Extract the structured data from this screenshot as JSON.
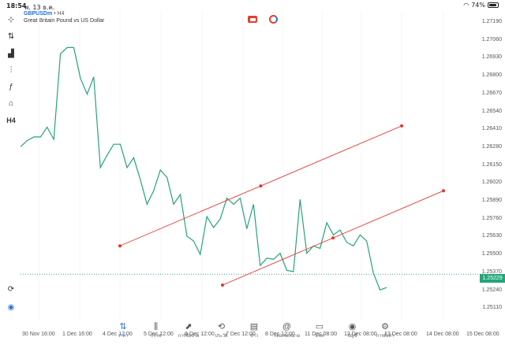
{
  "status_bar": {
    "time": "18:54",
    "date": "พ. 13 ธ.ค.",
    "battery": "74%",
    "battery_level": 0.74
  },
  "symbol": {
    "name": "GBPUSDm",
    "separator": "•",
    "timeframe": "H4",
    "description": "Great Britain Pound vs US Dollar"
  },
  "toolbar": {
    "items": [
      {
        "name": "crosshair-icon",
        "glyph": "⊹"
      },
      {
        "name": "chart-type-icon",
        "glyph": "⇅"
      },
      {
        "name": "indicators-icon",
        "glyph": "▟"
      },
      {
        "name": "settings-sliders-icon",
        "glyph": "⫶"
      },
      {
        "name": "function-icon",
        "glyph": "ƒ"
      },
      {
        "name": "shapes-icon",
        "glyph": "⌂"
      },
      {
        "name": "timeframe-label",
        "glyph": "H4"
      }
    ],
    "bottom_items": [
      {
        "name": "zoom-icon",
        "glyph": "⟳"
      },
      {
        "name": "broker-icon",
        "glyph": "◉"
      }
    ]
  },
  "price_axis": [
    "1.27190",
    "1.27060",
    "1.26930",
    "1.26800",
    "1.26670",
    "1.26540",
    "1.26410",
    "1.26280",
    "1.26150",
    "1.26020",
    "1.25890",
    "1.25760",
    "1.25630",
    "1.25500",
    "1.25370",
    "1.25240",
    "1.25110"
  ],
  "current_price": "1.25229",
  "time_axis": [
    "30 Nov 16:00",
    "1 Dec 16:00",
    "4 Dec 12:00",
    "5 Dec 12:00",
    "6 Dec 12:00",
    "7 Dec 12:00",
    "8 Dec 12:00",
    "11 Dec 08:00",
    "12 Dec 08:00",
    "13 Dec 08:00",
    "14 Dec 08:00",
    "15 Dec 08:00"
  ],
  "colors": {
    "line": "#26a37a",
    "trend": "#e3342f",
    "accent": "#2f6fd8",
    "grid": "#eeeeee"
  },
  "bottom_nav": [
    {
      "name": "nav-quotes",
      "label": "ราคา",
      "icon": "⇅",
      "active": true
    },
    {
      "name": "nav-chart",
      "label": "กราฟ",
      "icon": "⫼",
      "active": false
    },
    {
      "name": "nav-trade",
      "label": "การซื้อขาย",
      "icon": "⬈",
      "active": false
    },
    {
      "name": "nav-history",
      "label": "ประวัติ",
      "icon": "⟲",
      "active": false
    },
    {
      "name": "nav-news",
      "label": "ข่าว",
      "icon": "▤",
      "active": false
    },
    {
      "name": "nav-mailbox",
      "label": "กล่องจดหมาย",
      "icon": "@",
      "active": false
    },
    {
      "name": "nav-chat",
      "label": "แชท",
      "icon": "▭",
      "active": false
    },
    {
      "name": "nav-accounts",
      "label": "บัญชี",
      "icon": "◉",
      "active": false
    },
    {
      "name": "nav-settings",
      "label": "การตั้งค่า",
      "icon": "⚙",
      "active": false
    }
  ],
  "chart_data": {
    "type": "line",
    "series": [
      {
        "values": [
          1.2627,
          1.2632,
          1.2635,
          1.2635,
          1.2643,
          1.2633,
          1.2703,
          1.2708,
          1.2708,
          1.2683,
          1.267,
          1.2684,
          1.261,
          1.262,
          1.2629,
          1.2629,
          1.261,
          1.2618,
          1.26,
          1.258,
          1.2591,
          1.2608,
          1.2602,
          1.258,
          1.2588,
          1.2554,
          1.255,
          1.2539,
          1.257,
          1.2561,
          1.2568,
          1.2585,
          1.258,
          1.2585,
          1.256,
          1.258,
          1.253,
          1.2536,
          1.2535,
          1.254,
          1.2526,
          1.2525,
          1.2584,
          1.254,
          1.2546,
          1.2544,
          1.2565,
          1.2555,
          1.2559,
          1.2549,
          1.2546,
          1.2555,
          1.255,
          1.2524,
          1.251,
          1.2512
        ]
      }
    ],
    "trendlines": [
      {
        "p1": [
          "4 Dec 12:00",
          1.2546
        ],
        "p2": [
          "13 Dec 08:00",
          1.2644
        ]
      },
      {
        "p1": [
          "7 Dec 08:00",
          1.2514
        ],
        "p2": [
          "14 Dec 08:00",
          1.2591
        ]
      }
    ],
    "ylim": [
      1.2505,
      1.2725
    ],
    "current_price": 1.25229,
    "grid": true
  }
}
